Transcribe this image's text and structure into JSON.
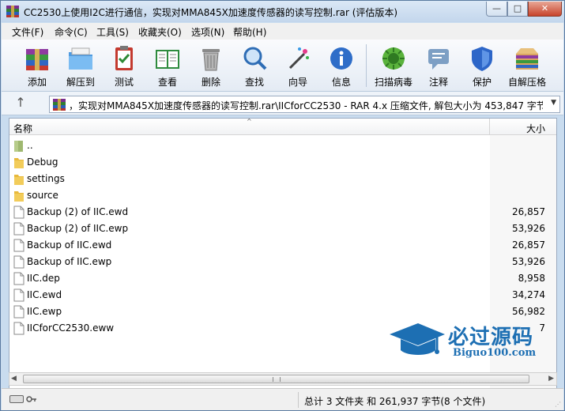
{
  "window": {
    "title": "CC2530上使用I2C进行通信，实现对MMA845X加速度传感器的读写控制.rar (评估版本)",
    "controls": {
      "minimize": "—",
      "maximize": "□",
      "close": "✕"
    }
  },
  "menu": [
    {
      "label": "文件(F)"
    },
    {
      "label": "命令(C)"
    },
    {
      "label": "工具(S)"
    },
    {
      "label": "收藏夹(O)"
    },
    {
      "label": "选项(N)"
    },
    {
      "label": "帮助(H)"
    }
  ],
  "toolbar": [
    {
      "label": "添加",
      "icon": "add-archive-icon"
    },
    {
      "label": "解压到",
      "icon": "extract-folder-icon"
    },
    {
      "label": "测试",
      "icon": "test-clipboard-icon"
    },
    {
      "label": "查看",
      "icon": "view-book-icon"
    },
    {
      "label": "删除",
      "icon": "trash-icon"
    },
    {
      "label": "查找",
      "icon": "magnifier-icon"
    },
    {
      "label": "向导",
      "icon": "wizard-wand-icon"
    },
    {
      "label": "信息",
      "icon": "info-icon"
    },
    {
      "label": "扫描病毒",
      "icon": "virus-scan-icon"
    },
    {
      "label": "注释",
      "icon": "comment-icon"
    },
    {
      "label": "保护",
      "icon": "shield-icon"
    },
    {
      "label": "自解压格",
      "icon": "sfx-box-icon"
    }
  ],
  "address": {
    "up_glyph": "↑",
    "path": "，实现对MMA845X加速度传感器的读写控制.rar\\IICforCC2530 - RAR 4.x 压缩文件, 解包大小为 453,847 字节",
    "dropdown": "▼"
  },
  "list": {
    "col_name": "名称",
    "col_size": "大小",
    "sort_glyph": "^",
    "rows": [
      {
        "name": "..",
        "size": "",
        "type": "parent"
      },
      {
        "name": "Debug",
        "size": "",
        "type": "folder"
      },
      {
        "name": "settings",
        "size": "",
        "type": "folder"
      },
      {
        "name": "source",
        "size": "",
        "type": "folder"
      },
      {
        "name": "Backup (2) of IIC.ewd",
        "size": "26,857",
        "type": "file"
      },
      {
        "name": "Backup (2) of IIC.ewp",
        "size": "53,926",
        "type": "file"
      },
      {
        "name": "Backup of IIC.ewd",
        "size": "26,857",
        "type": "file"
      },
      {
        "name": "Backup of IIC.ewp",
        "size": "53,926",
        "type": "file"
      },
      {
        "name": "IIC.dep",
        "size": "8,958",
        "type": "file"
      },
      {
        "name": "IIC.ewd",
        "size": "34,274",
        "type": "file"
      },
      {
        "name": "IIC.ewp",
        "size": "56,982",
        "type": "file"
      },
      {
        "name": "IICforCC2530.eww",
        "size": "7",
        "type": "file"
      }
    ]
  },
  "scrollbar": {
    "left": "◀",
    "right": "▶"
  },
  "status": {
    "text": "总计 3 文件夹 和 261,937 字节(8 个文件)"
  },
  "watermark": {
    "cn": "必过源码",
    "en": "Biguo100.com"
  },
  "colors": {
    "accent": "#1d6fb3",
    "folder": "#e8b93c",
    "titlebar": "#c9dcef"
  }
}
